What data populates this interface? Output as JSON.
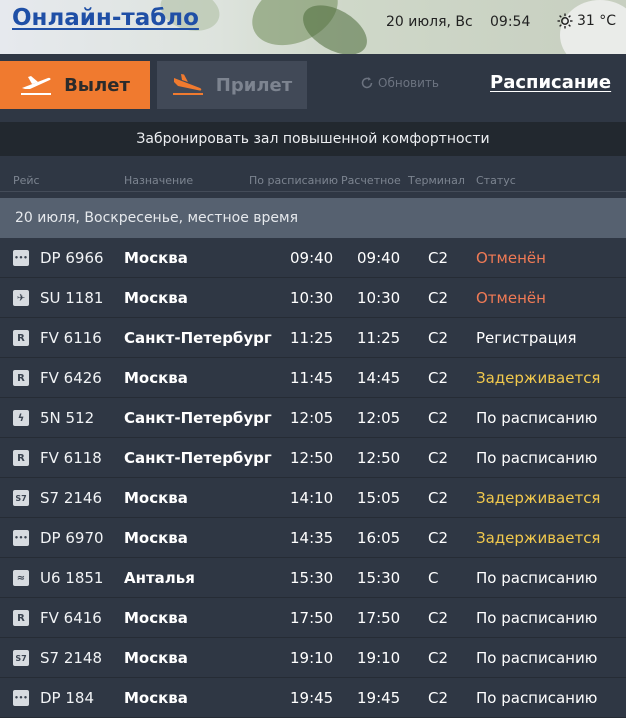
{
  "header": {
    "title": "Онлайн-табло",
    "date": "20 июля, Вс",
    "time": "09:54",
    "temperature": "31 °C"
  },
  "toolbar": {
    "departures_label": "Вылет",
    "arrivals_label": "Прилет",
    "refresh_label": "Обновить",
    "schedule_label": "Расписание"
  },
  "banner": "Забронировать зал повышенной комфортности",
  "columns": {
    "flight": "Рейс",
    "destination": "Назначение",
    "scheduled": "По расписанию",
    "estimated": "Расчетное",
    "terminal": "Терминал",
    "status": "Статус"
  },
  "day_header": "20 июля, Воскресенье, местное время",
  "colors": {
    "accent": "#f07a2f",
    "cancel": "#f07a55",
    "delay": "#f2c94c"
  },
  "flights": [
    {
      "airline_icon": "dots-logo-icon",
      "flight": "DP 6966",
      "destination": "Москва",
      "scheduled": "09:40",
      "estimated": "09:40",
      "terminal": "C2",
      "status": "Отменён",
      "status_type": "cancel"
    },
    {
      "airline_icon": "swoosh-logo-icon",
      "flight": "SU 1181",
      "destination": "Москва",
      "scheduled": "10:30",
      "estimated": "10:30",
      "terminal": "C2",
      "status": "Отменён",
      "status_type": "cancel"
    },
    {
      "airline_icon": "r-logo-icon",
      "flight": "FV 6116",
      "destination": "Санкт-Петербург",
      "scheduled": "11:25",
      "estimated": "11:25",
      "terminal": "C2",
      "status": "Регистрация",
      "status_type": "normal"
    },
    {
      "airline_icon": "r-logo-icon",
      "flight": "FV 6426",
      "destination": "Москва",
      "scheduled": "11:45",
      "estimated": "14:45",
      "terminal": "C2",
      "status": "Задерживается",
      "status_type": "delay"
    },
    {
      "airline_icon": "bird-logo-icon",
      "flight": "5N 512",
      "destination": "Санкт-Петербург",
      "scheduled": "12:05",
      "estimated": "12:05",
      "terminal": "C2",
      "status": "По расписанию",
      "status_type": "normal"
    },
    {
      "airline_icon": "r-logo-icon",
      "flight": "FV 6118",
      "destination": "Санкт-Петербург",
      "scheduled": "12:50",
      "estimated": "12:50",
      "terminal": "C2",
      "status": "По расписанию",
      "status_type": "normal"
    },
    {
      "airline_icon": "s7-logo-icon",
      "flight": "S7 2146",
      "destination": "Москва",
      "scheduled": "14:10",
      "estimated": "15:05",
      "terminal": "C2",
      "status": "Задерживается",
      "status_type": "delay"
    },
    {
      "airline_icon": "dots-logo-icon",
      "flight": "DP 6970",
      "destination": "Москва",
      "scheduled": "14:35",
      "estimated": "16:05",
      "terminal": "C2",
      "status": "Задерживается",
      "status_type": "delay"
    },
    {
      "airline_icon": "wave-logo-icon",
      "flight": "U6 1851",
      "destination": "Анталья",
      "scheduled": "15:30",
      "estimated": "15:30",
      "terminal": "C",
      "status": "По расписанию",
      "status_type": "normal"
    },
    {
      "airline_icon": "r-logo-icon",
      "flight": "FV 6416",
      "destination": "Москва",
      "scheduled": "17:50",
      "estimated": "17:50",
      "terminal": "C2",
      "status": "По расписанию",
      "status_type": "normal"
    },
    {
      "airline_icon": "s7-logo-icon",
      "flight": "S7 2148",
      "destination": "Москва",
      "scheduled": "19:10",
      "estimated": "19:10",
      "terminal": "C2",
      "status": "По расписанию",
      "status_type": "normal"
    },
    {
      "airline_icon": "dots-logo-icon",
      "flight": "DP 184",
      "destination": "Москва",
      "scheduled": "19:45",
      "estimated": "19:45",
      "terminal": "C2",
      "status": "По расписанию",
      "status_type": "normal"
    }
  ]
}
